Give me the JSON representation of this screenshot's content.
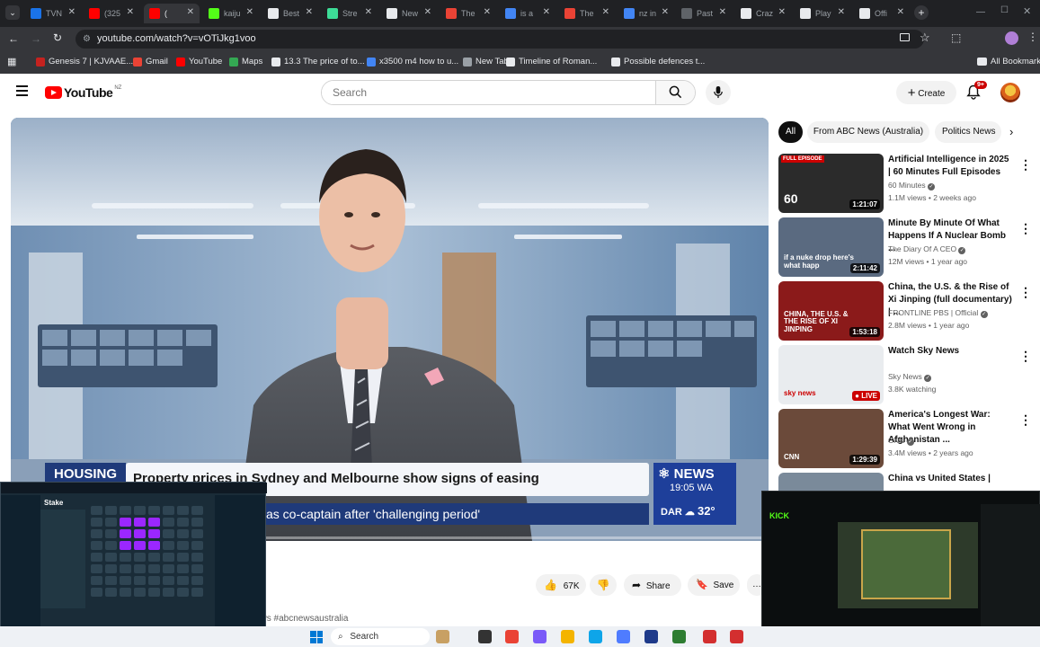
{
  "browser": {
    "tabs": [
      {
        "label": "TVN",
        "color": "#1a73e8"
      },
      {
        "label": "(325",
        "color": "#ff0000"
      },
      {
        "label": "(",
        "color": "#ff0000"
      },
      {
        "label": "kaiju",
        "color": "#53fc18"
      },
      {
        "label": "Best",
        "color": "#e8eaed"
      },
      {
        "label": "Stre",
        "color": "#3ddc97"
      },
      {
        "label": "New",
        "color": "#e8eaed"
      },
      {
        "label": "The",
        "color": "#ea4335"
      },
      {
        "label": "is a",
        "color": "#4285f4"
      },
      {
        "label": "The",
        "color": "#ea4335"
      },
      {
        "label": "nz in",
        "color": "#4285f4"
      },
      {
        "label": "Past",
        "color": "#5f6368"
      },
      {
        "label": "Craz",
        "color": "#e8eaed"
      },
      {
        "label": "Play",
        "color": "#e8eaed"
      },
      {
        "label": "Offi",
        "color": "#e8eaed"
      }
    ],
    "url": "youtube.com/watch?v=vOTiJkg1voo",
    "bookmarks": [
      {
        "label": "Genesis 7 | KJVAAE...",
        "color": "#c5221f"
      },
      {
        "label": "Gmail",
        "color": "#ea4335"
      },
      {
        "label": "YouTube",
        "color": "#ff0000"
      },
      {
        "label": "Maps",
        "color": "#34a853"
      },
      {
        "label": "13.3 The price of to...",
        "color": "#e8eaed"
      },
      {
        "label": "x3500 m4 how to u...",
        "color": "#4285f4"
      },
      {
        "label": "New Tab",
        "color": "#9aa0a6"
      },
      {
        "label": "Timeline of Roman...",
        "color": "#e8eaed"
      },
      {
        "label": "Possible defences t...",
        "color": "#e8eaed"
      }
    ],
    "all_bookmarks": "All Bookmarks"
  },
  "youtube": {
    "logo_text": "YouTube",
    "region": "NZ",
    "search_placeholder": "Search",
    "create_label": "Create",
    "notification_count": "9+",
    "chips": [
      "All",
      "From ABC News (Australia)",
      "Politics News"
    ],
    "video": {
      "topic": "HOUSING",
      "headline": "Property prices in Sydney and Melbourne show signs of easing",
      "ticker": "as co-captain after 'challenging period'",
      "channel_logo": "NEWS",
      "time": "19:05 WA",
      "city": "DAR",
      "temperature": "32°"
    },
    "hashtags": "ews #abcnewsaustralia",
    "actions": {
      "likes": "67K",
      "share": "Share",
      "save": "Save"
    },
    "recommendations": [
      {
        "title": "Artificial Intelligence in 2025 | 60 Minutes Full Episodes",
        "channel": "60 Minutes",
        "meta": "1.1M views • 2 weeks ago",
        "duration": "1:21:07",
        "badge": "FULL EPISODE",
        "thumb_text": "60",
        "thumb_color": "#2b2b2b"
      },
      {
        "title": "Minute By Minute Of What Happens If A Nuclear Bomb ...",
        "channel": "The Diary Of A CEO",
        "meta": "12M views • 1 year ago",
        "duration": "2:11:42",
        "badge": "",
        "thumb_text": "if a nuke drop here's what happ",
        "thumb_color": "#5a6a80"
      },
      {
        "title": "China, the U.S. & the Rise of Xi Jinping (full documentary) | ...",
        "channel": "FRONTLINE PBS | Official",
        "meta": "2.8M views • 1 year ago",
        "duration": "1:53:18",
        "badge": "",
        "thumb_text": "CHINA, THE U.S. & THE RISE OF XI JINPING",
        "thumb_color": "#8b1a1a"
      },
      {
        "title": "Watch Sky News",
        "channel": "Sky News",
        "meta": "3.8K watching",
        "duration": "LIVE",
        "badge": "",
        "thumb_text": "sky news",
        "thumb_color": "#e9ecef"
      },
      {
        "title": "America's Longest War: What Went Wrong in Afghanistan ...",
        "channel": "CNN",
        "meta": "3.4M views • 2 years ago",
        "duration": "1:29:39",
        "badge": "",
        "thumb_text": "CNN",
        "thumb_color": "#6b4a3a"
      },
      {
        "title": "China vs United States | Behind the Military Buildup ...",
        "channel": "",
        "meta": "",
        "duration": "",
        "badge": "",
        "thumb_text": "",
        "thumb_color": "#7a8a9a"
      }
    ]
  },
  "taskbar": {
    "search_placeholder": "Search"
  },
  "overlays": {
    "left_app": "Stake",
    "right_app": "KICK"
  }
}
